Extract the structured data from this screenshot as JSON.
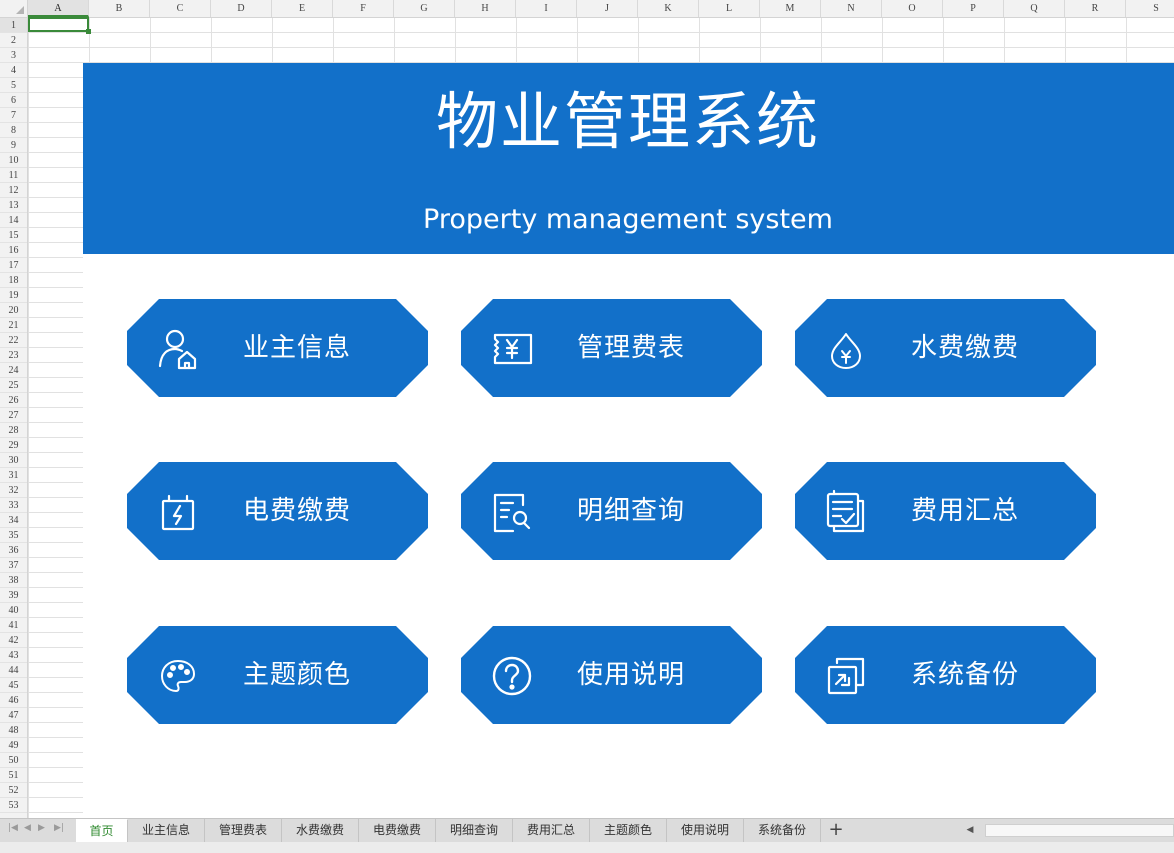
{
  "spreadsheet": {
    "columns": [
      "A",
      "B",
      "C",
      "D",
      "E",
      "F",
      "G",
      "H",
      "I",
      "J",
      "K",
      "L",
      "M",
      "N",
      "O",
      "P",
      "Q",
      "R",
      "S"
    ],
    "rows": [
      "1",
      "2",
      "3",
      "4",
      "5",
      "6",
      "7",
      "8",
      "9",
      "10",
      "11",
      "12",
      "13",
      "14",
      "15",
      "16",
      "17",
      "18",
      "19",
      "20",
      "21",
      "22",
      "23",
      "24",
      "25",
      "26",
      "27",
      "28",
      "29",
      "30",
      "31",
      "32",
      "33",
      "34",
      "35",
      "36",
      "37",
      "38",
      "39",
      "40",
      "41",
      "42",
      "43",
      "44",
      "45",
      "46",
      "47",
      "48",
      "49",
      "50",
      "51",
      "52",
      "53"
    ],
    "selected_cell": "A1"
  },
  "banner": {
    "title": "物业管理系统",
    "subtitle": "Property management system",
    "color": "#1270c9"
  },
  "tiles": [
    {
      "label": "业主信息",
      "icon": "owner-house-icon"
    },
    {
      "label": "管理费表",
      "icon": "yuan-ticket-icon"
    },
    {
      "label": "水费缴费",
      "icon": "water-drop-yuan-icon"
    },
    {
      "label": "电费缴费",
      "icon": "battery-bolt-icon"
    },
    {
      "label": "明细查询",
      "icon": "document-search-icon"
    },
    {
      "label": "费用汇总",
      "icon": "checklist-icon"
    },
    {
      "label": "主题颜色",
      "icon": "palette-icon"
    },
    {
      "label": "使用说明",
      "icon": "help-circle-icon"
    },
    {
      "label": "系统备份",
      "icon": "backup-copy-icon"
    }
  ],
  "sheet_tabs": [
    "首页",
    "业主信息",
    "管理费表",
    "水费缴费",
    "电费缴费",
    "明细查询",
    "费用汇总",
    "主题颜色",
    "使用说明",
    "系统备份"
  ],
  "active_tab": "首页",
  "accent_colors": {
    "selection": "#3a8a3a",
    "tile": "#1270c9"
  }
}
